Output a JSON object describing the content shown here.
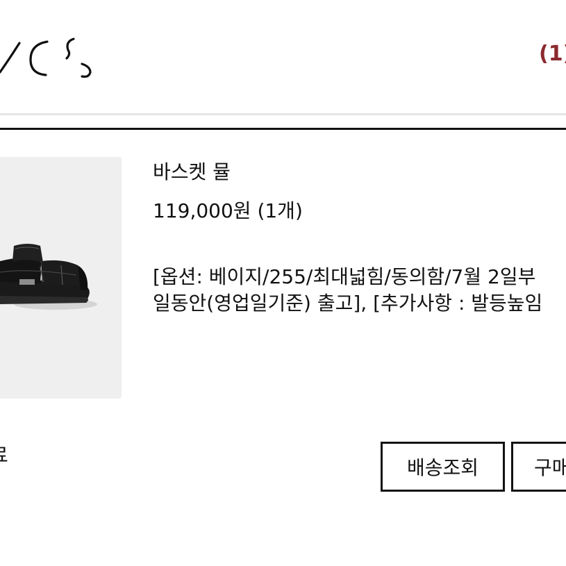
{
  "header": {
    "logo_icon": "brand-logo-icon",
    "cart_count": "(1)",
    "accent_color": "#8b2a2e"
  },
  "order_item": {
    "image_icon": "sandal-product-image",
    "name": "바스켓 뮬",
    "price": "119,000원 (1개)",
    "options_line1": "[옵션: 베이지/255/최대넓힘/동의함/7월 2일부",
    "options_line2": "일동안(영업일기준) 출고], [추가사항 : 발등높임"
  },
  "order_status": {
    "label": "료"
  },
  "actions": {
    "track_label": "배송조회",
    "confirm_label": "구매"
  }
}
